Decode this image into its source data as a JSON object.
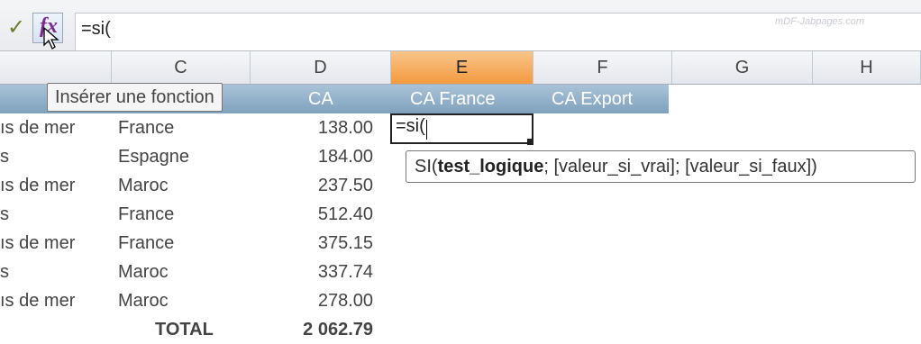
{
  "formula_bar": {
    "confirm_icon": "check-icon",
    "fx_icon": "insert-function-icon",
    "fx_glyph": "fx",
    "formula": "=si("
  },
  "watermark": "mDF-Jabpages.com",
  "columns": [
    "C",
    "D",
    "E",
    "F",
    "G",
    "H"
  ],
  "active_column": "E",
  "header_row": {
    "col_d": "CA",
    "col_e": "CA France",
    "col_f": "CA Export"
  },
  "tooltip_insert_function": "Insérer une fonction",
  "rows": [
    {
      "b": "ıs de mer",
      "c": "France",
      "d": "138.00"
    },
    {
      "b": "s",
      "c": "Espagne",
      "d": "184.00"
    },
    {
      "b": "ıs de mer",
      "c": "Maroc",
      "d": "237.50"
    },
    {
      "b": "s",
      "c": "France",
      "d": "512.40"
    },
    {
      "b": "ıs de mer",
      "c": "France",
      "d": "375.15"
    },
    {
      "b": "s",
      "c": "Maroc",
      "d": "337.74"
    },
    {
      "b": "ıs de mer",
      "c": "Maroc",
      "d": "278.00"
    }
  ],
  "total_row": {
    "label": "TOTAL",
    "value": "2 062.79"
  },
  "active_cell": {
    "value": "=si("
  },
  "function_tooltip": {
    "prefix": "SI(",
    "bold_arg": "test_logique",
    "rest": "; [valeur_si_vrai]; [valeur_si_faux])"
  },
  "colors": {
    "active_column_header": "#f39a3e",
    "table_header": "#8fb0c9",
    "fx_glyph": "#7a2a8a"
  }
}
